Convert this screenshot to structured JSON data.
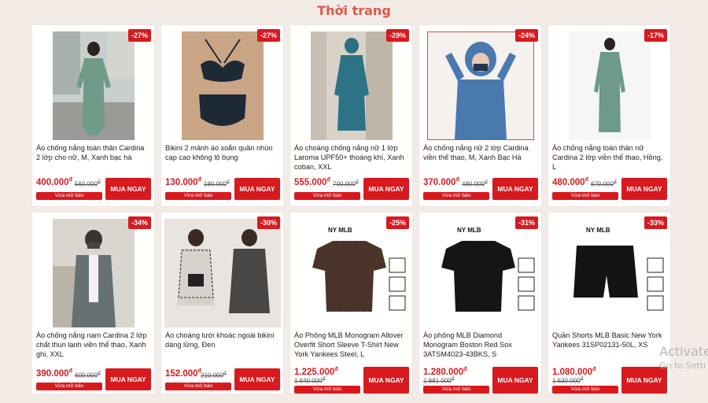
{
  "section": {
    "title": "Thời trang"
  },
  "products": [
    {
      "name": "Áo chống nắng toàn thân Cardina 2 lớp cho nữ, M, Xanh bạc hà",
      "price": "400.000",
      "old_price": "560.000",
      "discount": "-27%",
      "sold": "Vừa mở bán",
      "buy": "MUA NGAY",
      "image": "woman-long-hood-green"
    },
    {
      "name": "Bikini 2 mảnh áo xoắn quần nhún cạp cao không lộ bụng",
      "price": "130.000",
      "old_price": "180.000",
      "discount": "-27%",
      "sold": "Vừa mở bán",
      "buy": "MUA NGAY",
      "image": "navy-bikini"
    },
    {
      "name": "Áo choàng chống nắng nữ 1 lớp Laroma UPF50+ thoáng khí, Xanh coban, XXL",
      "price": "555.000",
      "old_price": "700.000",
      "discount": "-29%",
      "sold": "Vừa mở bán",
      "buy": "MUA NGAY",
      "image": "woman-long-cloak-teal"
    },
    {
      "name": "Áo chống nắng nữ 2 lớp Cardina viền thể thao, M, Xanh Bạc Hà",
      "price": "370.000",
      "old_price": "480.000",
      "discount": "-24%",
      "sold": "Vừa mở bán",
      "buy": "MUA NGAY",
      "image": "woman-hood-mask-blue"
    },
    {
      "name": "Áo chống nắng toàn thân nữ Cardina 2 lớp viền thể thao, Hồng, L",
      "price": "480.000",
      "old_price": "670.000",
      "discount": "-17%",
      "sold": "Vừa mở bán",
      "buy": "MUA NGAY",
      "image": "woman-long-green"
    },
    {
      "name": "Áo chống nắng nam Cardina 2 lớp chất thun lạnh viền thể thao, Xanh ghi, XXL",
      "price": "390.000",
      "old_price": "600.000",
      "discount": "-34%",
      "sold": "Vừa mở bán",
      "buy": "MUA NGAY",
      "image": "man-grey-hoodie"
    },
    {
      "name": "Áo choàng lưới khoác ngoài bikini dáng lửng, Đen",
      "price": "152.000",
      "old_price": "210.000",
      "discount": "-30%",
      "sold": "Vừa mở bán",
      "buy": "MUA NGAY",
      "image": "two-women-mesh"
    },
    {
      "name": "Áo Phông MLB Monogram Allover Overfit Short Sleeve T-Shirt New York Yankees Steel, L",
      "price": "1.225.000",
      "old_price": "1.640.000",
      "discount": "-25%",
      "sold": "Vừa mở bán",
      "buy": "MUA NGAY",
      "image": "mlb-tshirt-brown"
    },
    {
      "name": "Áo phông MLB Diamond Monogram Boston Red Sox 3ATSM4023-43BKS, S",
      "price": "1.280.000",
      "old_price": "1.881.000",
      "discount": "-31%",
      "sold": "Vừa mở bán",
      "buy": "MUA NGAY",
      "image": "mlb-tshirt-black"
    },
    {
      "name": "Quần Shorts MLB Basic New York Yankees 31SP02131-50L, XS",
      "price": "1.080.000",
      "old_price": "1.630.000",
      "discount": "-33%",
      "sold": "Vừa mở bán",
      "buy": "MUA NGAY",
      "image": "mlb-shorts-black"
    }
  ],
  "mlb_logo": "NY MLB",
  "overlay": {
    "line1": "Activate",
    "line2": "Go to Setti"
  },
  "colors": {
    "accent": "#d81a1f",
    "title": "#e0584a",
    "background": "#f3ebe6"
  }
}
